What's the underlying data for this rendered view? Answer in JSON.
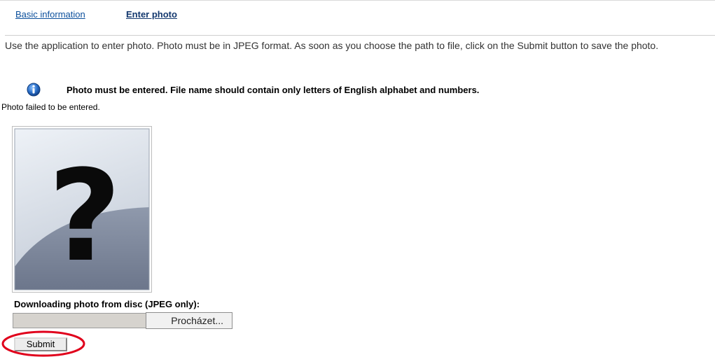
{
  "tabs": {
    "basic_info": "Basic information",
    "enter_photo": "Enter photo"
  },
  "intro_text": "Use the application to enter photo. Photo must be in JPEG format. As soon as you choose the path to file, click on the Submit button to save the photo.",
  "notice": {
    "icon": "info-icon",
    "text": "Photo must be entered. File name should contain only letters of English alphabet and numbers."
  },
  "status_text": "Photo failed to be entered.",
  "photo": {
    "placeholder_glyph": "?"
  },
  "upload": {
    "label": "Downloading photo from disc (JPEG only):",
    "file_value": "",
    "browse_label": "Procházet..."
  },
  "submit_label": "Submit",
  "colors": {
    "link": "#0b4f9c",
    "highlight": "#e0001b",
    "info_blue": "#2a6fc9"
  }
}
